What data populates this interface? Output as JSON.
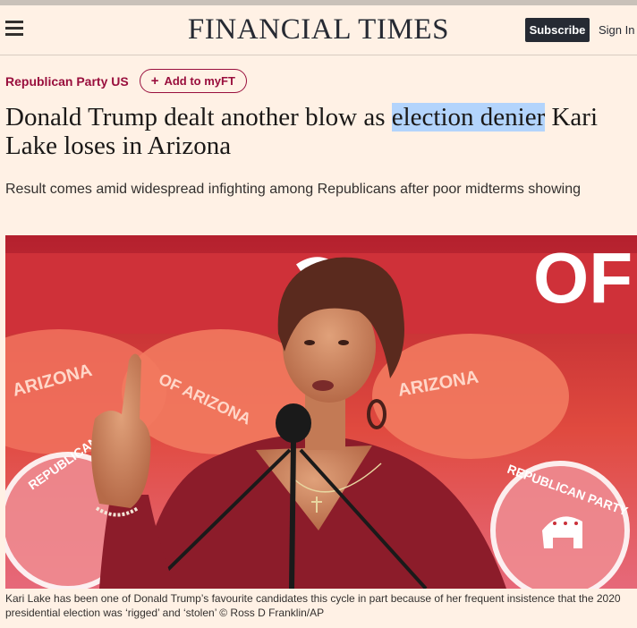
{
  "header": {
    "logo": "FINANCIAL TIMES",
    "subscribe_label": "Subscribe",
    "signin_label": "Sign In"
  },
  "article": {
    "topic": "Republican Party US",
    "add_myft_label": "Add to myFT",
    "headline_before": "Donald Trump dealt another blow as ",
    "headline_highlight": "election denier",
    "headline_after": " Kari Lake loses in Arizona",
    "standfirst": "Result comes amid widespread infighting among Republicans after poor midterms showing",
    "image_caption": "Kari Lake has been one of Donald Trump’s favourite candidates this cycle in part because of her frequent insistence that the 2020 presidential election was ‘rigged’ and ‘stolen’ © Ross D Franklin/AP",
    "photo_banner_text": [
      "ARIZONA",
      "OF ARIZONA",
      "OF ARIZONA",
      "ARIZONA",
      "ARIZONA",
      "REPUBLICAN PA",
      "REPUBLICAN PARTY",
      "OF AR"
    ]
  },
  "colors": {
    "background": "#fff1e5",
    "claret": "#990f3d",
    "subscribe_bg": "#262a33",
    "highlight": "#b3d4fc"
  }
}
